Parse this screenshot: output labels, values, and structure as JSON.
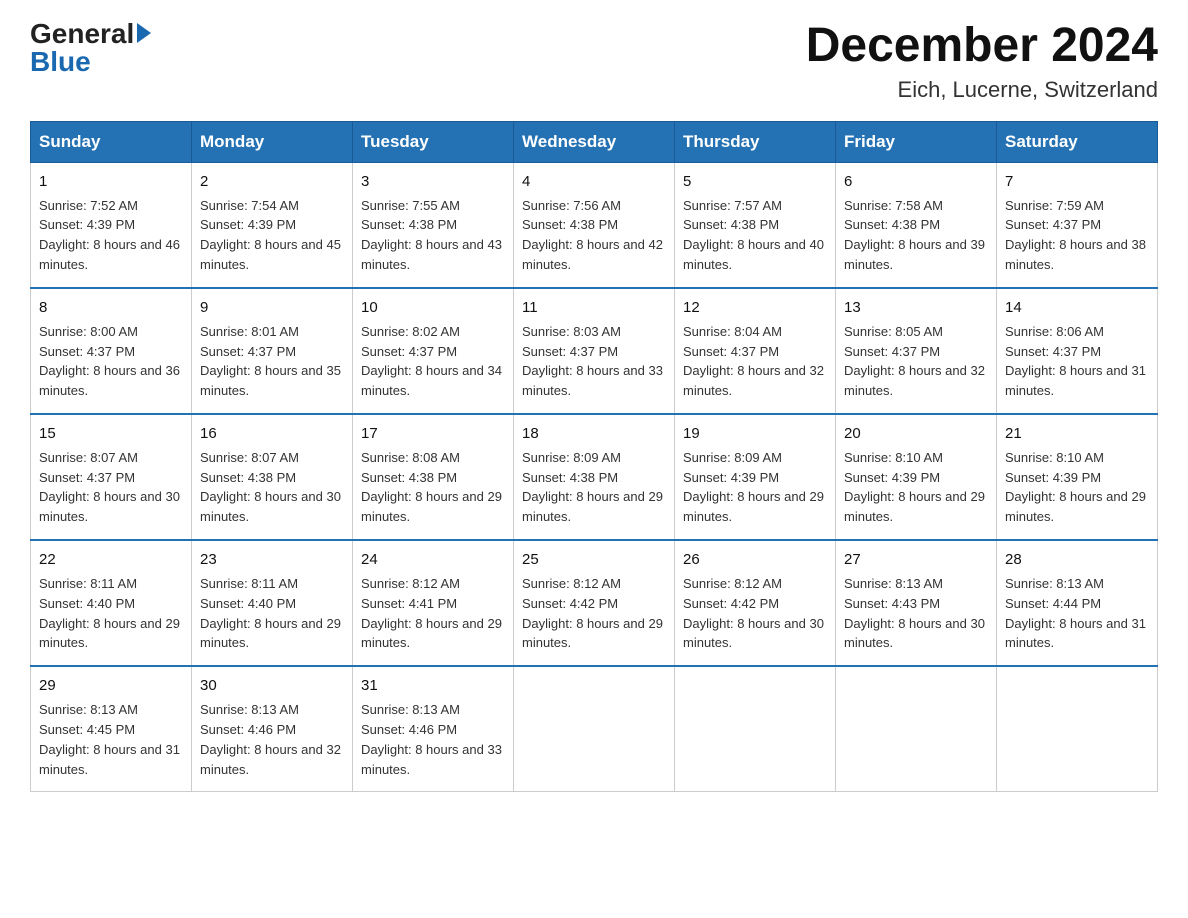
{
  "logo": {
    "general": "General",
    "blue": "Blue"
  },
  "title": "December 2024",
  "subtitle": "Eich, Lucerne, Switzerland",
  "days_of_week": [
    "Sunday",
    "Monday",
    "Tuesday",
    "Wednesday",
    "Thursday",
    "Friday",
    "Saturday"
  ],
  "weeks": [
    [
      {
        "day": "1",
        "sunrise": "7:52 AM",
        "sunset": "4:39 PM",
        "daylight": "8 hours and 46 minutes."
      },
      {
        "day": "2",
        "sunrise": "7:54 AM",
        "sunset": "4:39 PM",
        "daylight": "8 hours and 45 minutes."
      },
      {
        "day": "3",
        "sunrise": "7:55 AM",
        "sunset": "4:38 PM",
        "daylight": "8 hours and 43 minutes."
      },
      {
        "day": "4",
        "sunrise": "7:56 AM",
        "sunset": "4:38 PM",
        "daylight": "8 hours and 42 minutes."
      },
      {
        "day": "5",
        "sunrise": "7:57 AM",
        "sunset": "4:38 PM",
        "daylight": "8 hours and 40 minutes."
      },
      {
        "day": "6",
        "sunrise": "7:58 AM",
        "sunset": "4:38 PM",
        "daylight": "8 hours and 39 minutes."
      },
      {
        "day": "7",
        "sunrise": "7:59 AM",
        "sunset": "4:37 PM",
        "daylight": "8 hours and 38 minutes."
      }
    ],
    [
      {
        "day": "8",
        "sunrise": "8:00 AM",
        "sunset": "4:37 PM",
        "daylight": "8 hours and 36 minutes."
      },
      {
        "day": "9",
        "sunrise": "8:01 AM",
        "sunset": "4:37 PM",
        "daylight": "8 hours and 35 minutes."
      },
      {
        "day": "10",
        "sunrise": "8:02 AM",
        "sunset": "4:37 PM",
        "daylight": "8 hours and 34 minutes."
      },
      {
        "day": "11",
        "sunrise": "8:03 AM",
        "sunset": "4:37 PM",
        "daylight": "8 hours and 33 minutes."
      },
      {
        "day": "12",
        "sunrise": "8:04 AM",
        "sunset": "4:37 PM",
        "daylight": "8 hours and 32 minutes."
      },
      {
        "day": "13",
        "sunrise": "8:05 AM",
        "sunset": "4:37 PM",
        "daylight": "8 hours and 32 minutes."
      },
      {
        "day": "14",
        "sunrise": "8:06 AM",
        "sunset": "4:37 PM",
        "daylight": "8 hours and 31 minutes."
      }
    ],
    [
      {
        "day": "15",
        "sunrise": "8:07 AM",
        "sunset": "4:37 PM",
        "daylight": "8 hours and 30 minutes."
      },
      {
        "day": "16",
        "sunrise": "8:07 AM",
        "sunset": "4:38 PM",
        "daylight": "8 hours and 30 minutes."
      },
      {
        "day": "17",
        "sunrise": "8:08 AM",
        "sunset": "4:38 PM",
        "daylight": "8 hours and 29 minutes."
      },
      {
        "day": "18",
        "sunrise": "8:09 AM",
        "sunset": "4:38 PM",
        "daylight": "8 hours and 29 minutes."
      },
      {
        "day": "19",
        "sunrise": "8:09 AM",
        "sunset": "4:39 PM",
        "daylight": "8 hours and 29 minutes."
      },
      {
        "day": "20",
        "sunrise": "8:10 AM",
        "sunset": "4:39 PM",
        "daylight": "8 hours and 29 minutes."
      },
      {
        "day": "21",
        "sunrise": "8:10 AM",
        "sunset": "4:39 PM",
        "daylight": "8 hours and 29 minutes."
      }
    ],
    [
      {
        "day": "22",
        "sunrise": "8:11 AM",
        "sunset": "4:40 PM",
        "daylight": "8 hours and 29 minutes."
      },
      {
        "day": "23",
        "sunrise": "8:11 AM",
        "sunset": "4:40 PM",
        "daylight": "8 hours and 29 minutes."
      },
      {
        "day": "24",
        "sunrise": "8:12 AM",
        "sunset": "4:41 PM",
        "daylight": "8 hours and 29 minutes."
      },
      {
        "day": "25",
        "sunrise": "8:12 AM",
        "sunset": "4:42 PM",
        "daylight": "8 hours and 29 minutes."
      },
      {
        "day": "26",
        "sunrise": "8:12 AM",
        "sunset": "4:42 PM",
        "daylight": "8 hours and 30 minutes."
      },
      {
        "day": "27",
        "sunrise": "8:13 AM",
        "sunset": "4:43 PM",
        "daylight": "8 hours and 30 minutes."
      },
      {
        "day": "28",
        "sunrise": "8:13 AM",
        "sunset": "4:44 PM",
        "daylight": "8 hours and 31 minutes."
      }
    ],
    [
      {
        "day": "29",
        "sunrise": "8:13 AM",
        "sunset": "4:45 PM",
        "daylight": "8 hours and 31 minutes."
      },
      {
        "day": "30",
        "sunrise": "8:13 AM",
        "sunset": "4:46 PM",
        "daylight": "8 hours and 32 minutes."
      },
      {
        "day": "31",
        "sunrise": "8:13 AM",
        "sunset": "4:46 PM",
        "daylight": "8 hours and 33 minutes."
      },
      null,
      null,
      null,
      null
    ]
  ]
}
